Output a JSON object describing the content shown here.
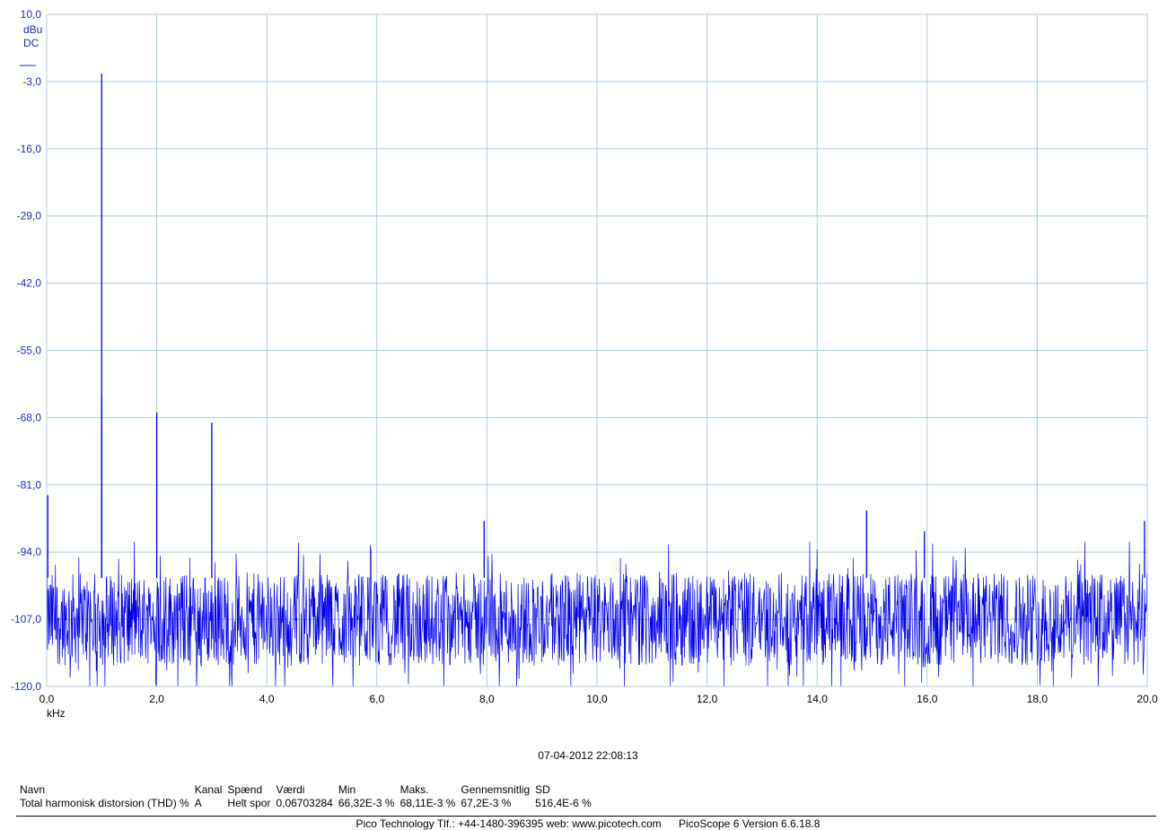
{
  "chart_data": {
    "type": "line",
    "y_unit": "dBu",
    "y_coupling": "DC",
    "x_unit": "kHz",
    "ylim": [
      -120.0,
      10.0
    ],
    "xlim": [
      0.0,
      20.0
    ],
    "y_ticks": [
      "10,0",
      "-3,0",
      "-16,0",
      "-29,0",
      "-42,0",
      "-55,0",
      "-68,0",
      "-81,0",
      "-94,0",
      "-107,0",
      "-120,0"
    ],
    "x_ticks": [
      "0,0",
      "2,0",
      "4,0",
      "6,0",
      "8,0",
      "10,0",
      "12,0",
      "14,0",
      "16,0",
      "18,0",
      "20,0"
    ],
    "grid": true,
    "line_color": "#0000ee",
    "grid_color": "#a8cce0",
    "noise_floor_db": -107,
    "peaks": [
      {
        "x": 0.02,
        "y": -83
      },
      {
        "x": 1.0,
        "y": -1.5
      },
      {
        "x": 1.0,
        "y": -64
      },
      {
        "x": 2.0,
        "y": -67
      },
      {
        "x": 3.0,
        "y": -69
      },
      {
        "x": 7.95,
        "y": -88
      },
      {
        "x": 14.9,
        "y": -86
      },
      {
        "x": 15.95,
        "y": -90
      },
      {
        "x": 19.95,
        "y": -88
      }
    ]
  },
  "timestamp": "07-04-2012 22:08:13",
  "measurements": {
    "headers": [
      "Navn",
      "Kanal",
      "Spænd",
      "Værdi",
      "Min",
      "Maks.",
      "Gennemsnitlig",
      "SD"
    ],
    "rows": [
      [
        "Total harmonisk distorsion (THD) %",
        "A",
        "Helt spor",
        "0,06703284",
        "66,32E-3 %",
        "68,11E-3 %",
        "67,2E-3 %",
        "516,4E-6 %"
      ]
    ]
  },
  "footer": {
    "company": "Pico Technology Tlf.: +44-1480-396395  web: www.picotech.com",
    "version": "PicoScope 6 Version 6.6.18.8"
  }
}
